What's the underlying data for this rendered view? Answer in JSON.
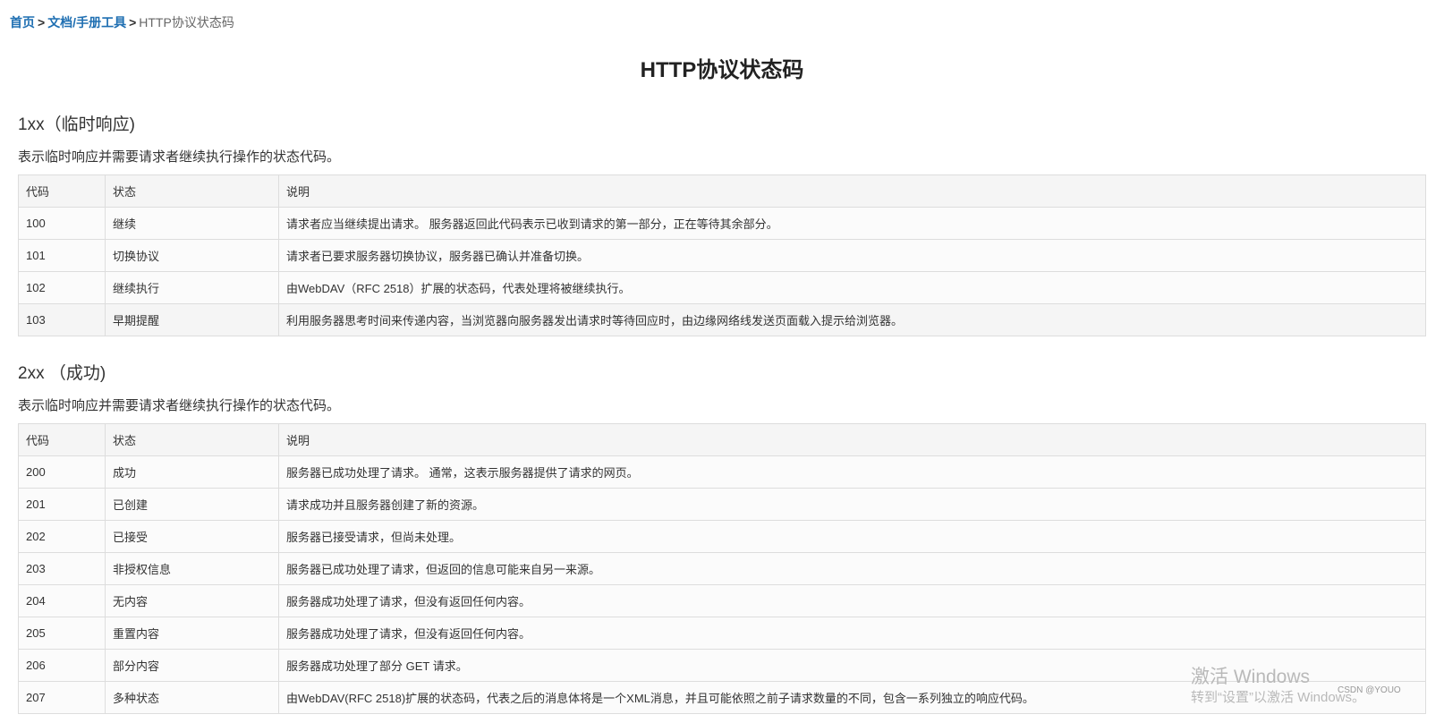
{
  "breadcrumb": {
    "home": "首页",
    "sep1": ">",
    "docs": "文档/手册工具",
    "sep2": ">",
    "current": "HTTP协议状态码"
  },
  "title": "HTTP协议状态码",
  "sections": [
    {
      "heading": "1xx（临时响应)",
      "description": "表示临时响应并需要请求者继续执行操作的状态代码。",
      "headers": [
        "代码",
        "状态",
        "说明"
      ],
      "rows": [
        [
          "100",
          "继续",
          "请求者应当继续提出请求。 服务器返回此代码表示已收到请求的第一部分，正在等待其余部分。"
        ],
        [
          "101",
          "切换协议",
          "请求者已要求服务器切换协议，服务器已确认并准备切换。"
        ],
        [
          "102",
          "继续执行",
          "由WebDAV（RFC 2518）扩展的状态码，代表处理将被继续执行。"
        ],
        [
          "103",
          "早期提醒",
          "利用服务器思考时间来传递内容，当浏览器向服务器发出请求时等待回应时，由边缘网络线发送页面载入提示给浏览器。"
        ]
      ]
    },
    {
      "heading": "2xx （成功)",
      "description": "表示临时响应并需要请求者继续执行操作的状态代码。",
      "headers": [
        "代码",
        "状态",
        "说明"
      ],
      "rows": [
        [
          "200",
          "成功",
          "服务器已成功处理了请求。 通常，这表示服务器提供了请求的网页。"
        ],
        [
          "201",
          "已创建",
          "请求成功并且服务器创建了新的资源。"
        ],
        [
          "202",
          "已接受",
          "服务器已接受请求，但尚未处理。"
        ],
        [
          "203",
          "非授权信息",
          "服务器已成功处理了请求，但返回的信息可能来自另一来源。"
        ],
        [
          "204",
          "无内容",
          "服务器成功处理了请求，但没有返回任何内容。"
        ],
        [
          "205",
          "重置内容",
          "服务器成功处理了请求，但没有返回任何内容。"
        ],
        [
          "206",
          "部分内容",
          "服务器成功处理了部分 GET 请求。"
        ],
        [
          "207",
          "多种状态",
          "由WebDAV(RFC 2518)扩展的状态码，代表之后的消息体将是一个XML消息，并且可能依照之前子请求数量的不同，包含一系列独立的响应代码。"
        ]
      ]
    }
  ],
  "watermark": {
    "line1": "激活 Windows",
    "line2": "转到“设置”以激活 Windows。",
    "csdn": "CSDN @YOUO"
  }
}
